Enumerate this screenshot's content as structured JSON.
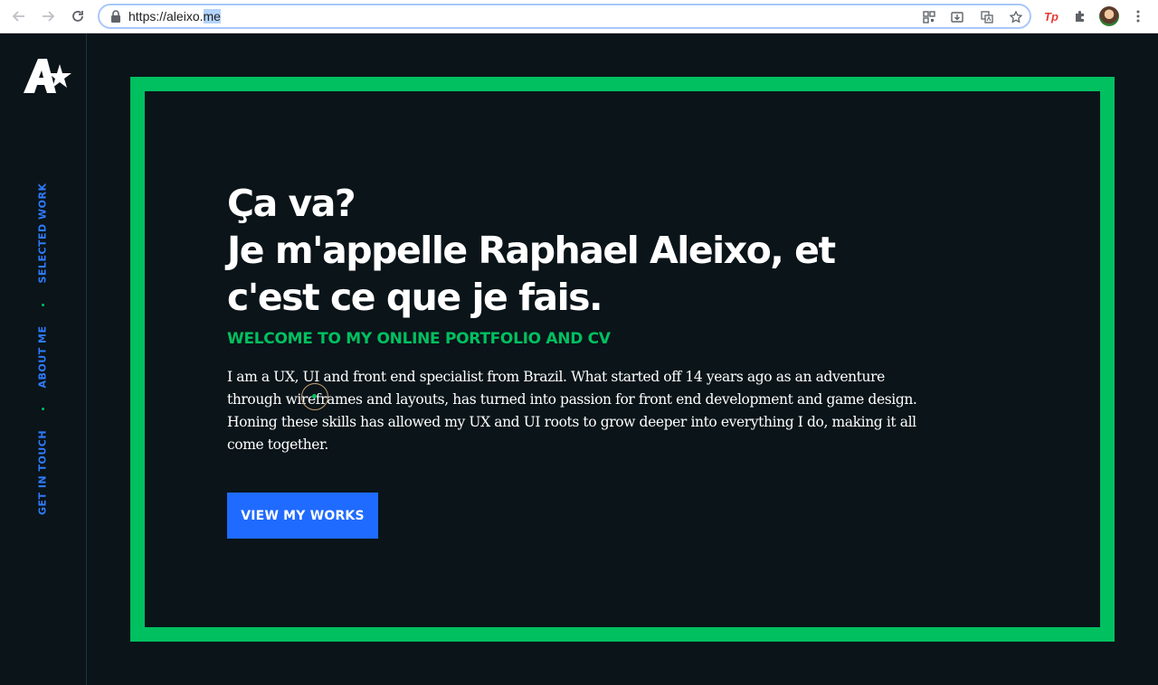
{
  "browser": {
    "url_prefix": "https://aleixo.",
    "url_selected": "me",
    "extension_tp_label": "Tp"
  },
  "sidebar": {
    "nav": [
      {
        "label": "SELECTED WORK"
      },
      {
        "label": "ABOUT ME"
      },
      {
        "label": "GET IN TOUCH"
      }
    ]
  },
  "hero": {
    "title_lines": [
      "Ça va?",
      "Je m'appelle Raphael Aleixo, et",
      "c'est ce que je fais."
    ],
    "subtitle": "WELCOME TO MY ONLINE PORTFOLIO AND CV",
    "bio": "I am a UX, UI and front end specialist from Brazil. What started off 14 years ago as an adventure through wireframes and layouts, has turned into passion for front end development and game design. Honing these skills has allowed my UX and UI roots to grow deeper into everything I do, making it all come together.",
    "cta_label": "VIEW MY WORKS"
  },
  "colors": {
    "background": "#0a1419",
    "accent_green": "#00c060",
    "accent_blue": "#1f6bff",
    "nav_blue": "#2f7bff"
  }
}
